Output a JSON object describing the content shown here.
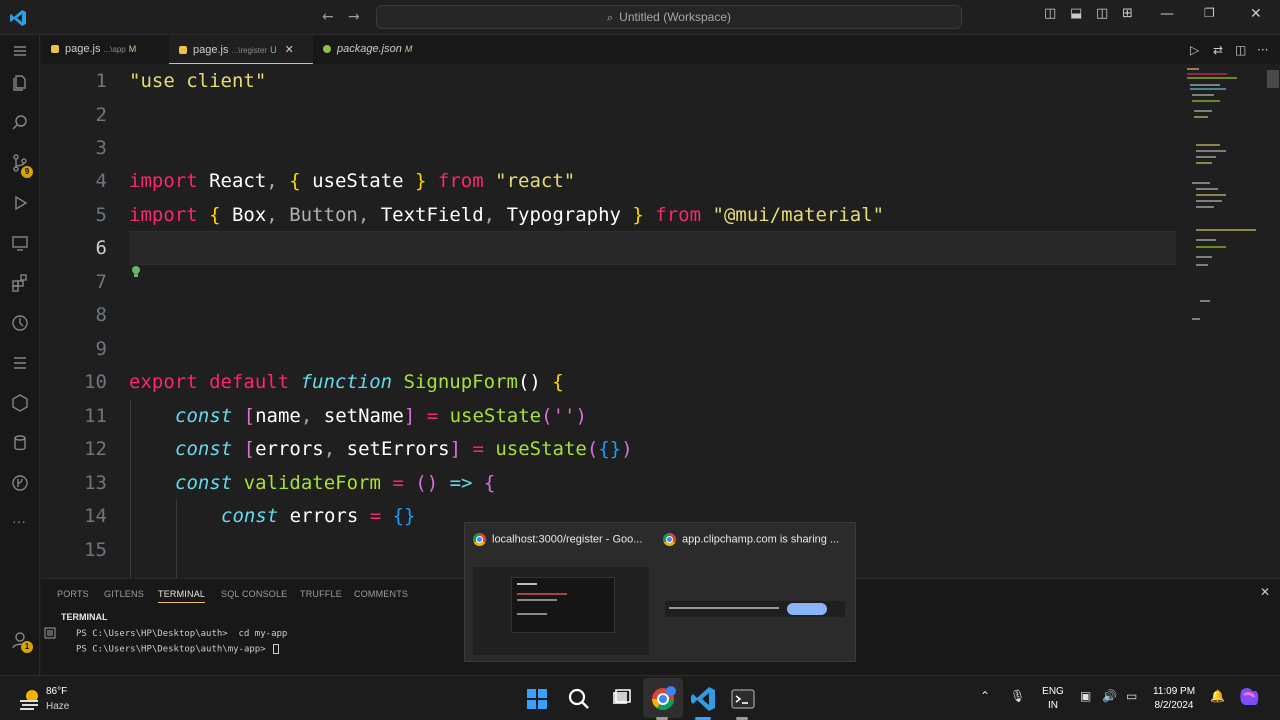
{
  "window": {
    "title": "Untitled (Workspace)",
    "search_icon": "search-icon",
    "back_icon": "arrow-left-icon",
    "forward_icon": "arrow-right-icon"
  },
  "tabs": [
    {
      "name": "page.js",
      "hint": "...\\app",
      "status": "M",
      "active": false
    },
    {
      "name": "page.js",
      "hint": "...\\register",
      "status": "U",
      "active": true
    },
    {
      "name": "package.json",
      "hint": "",
      "status": "M",
      "active": false
    }
  ],
  "activity_badges": {
    "source_control": "9",
    "accounts": "1"
  },
  "editor": {
    "current_line": 6,
    "line_numbers": [
      "1",
      "2",
      "3",
      "4",
      "5",
      "6",
      "7",
      "8",
      "9",
      "10",
      "11",
      "12",
      "13",
      "14",
      "15"
    ],
    "code": {
      "l1": "\"use client\"",
      "l4_import": "import",
      "l4_react": "React",
      "l4_comma": ", ",
      "l4_ob": "{",
      "l4_usestate": " useState ",
      "l4_cb": "}",
      "l4_from": " from ",
      "l4_str": "\"react\"",
      "l5_import": "import",
      "l5_ob": " {",
      "l5_box": " Box",
      "l5_c1": ",",
      "l5_button": " Button",
      "l5_c2": ",",
      "l5_textfield": " TextField",
      "l5_c3": ",",
      "l5_typography": " Typography ",
      "l5_cb": "}",
      "l5_from": " from ",
      "l5_str": "\"@mui/material\"",
      "l10_export": "export",
      "l10_default": " default ",
      "l10_function": "function",
      "l10_name": " SignupForm",
      "l10_paren": "()",
      "l10_ob": " {",
      "l11_const": "const",
      "l11_ob": " [",
      "l11_name": "name",
      "l11_comma": ",",
      "l11_setname": " setName",
      "l11_cb": "]",
      "l11_eq": " = ",
      "l11_fn": "useState",
      "l11_args": "('')",
      "l12_const": "const",
      "l12_ob": " [",
      "l12_errors": "errors",
      "l12_comma": ",",
      "l12_seterrors": " setErrors",
      "l12_cb": "]",
      "l12_eq": " = ",
      "l12_fn": "useState",
      "l12_p1": "(",
      "l12_obj": "{}",
      "l12_p2": ")",
      "l13_const": "const",
      "l13_name": " validateForm",
      "l13_eq": " = ",
      "l13_paren": "()",
      "l13_arrow": " => ",
      "l13_ob": "{",
      "l14_const": "const",
      "l14_errors": " errors",
      "l14_eq": " = ",
      "l14_obj": "{}"
    }
  },
  "panel": {
    "tabs": [
      "PORTS",
      "GITLENS",
      "TERMINAL",
      "SQL CONSOLE",
      "TRUFFLE",
      "COMMENTS"
    ],
    "active_tab": "TERMINAL",
    "terminal_title": "TERMINAL",
    "lines": [
      "PS C:\\Users\\HP\\Desktop\\auth>  cd my-app",
      "PS C:\\Users\\HP\\Desktop\\auth\\my-app> "
    ]
  },
  "taskbar_preview": {
    "windows": [
      {
        "title": "localhost:3000/register - Goo..."
      },
      {
        "title": "app.clipchamp.com is sharing ..."
      }
    ]
  },
  "taskbar": {
    "weather_temp": "86°F",
    "weather_cond": "Haze",
    "lang_line1": "ENG",
    "lang_line2": "IN",
    "time": "11:09 PM",
    "date": "8/2/2024"
  },
  "colors": {
    "keyword": "#f92672",
    "string": "#e6db74",
    "function": "#a6e22e",
    "storage": "#66d9ef",
    "accent": "#e7c06b"
  }
}
